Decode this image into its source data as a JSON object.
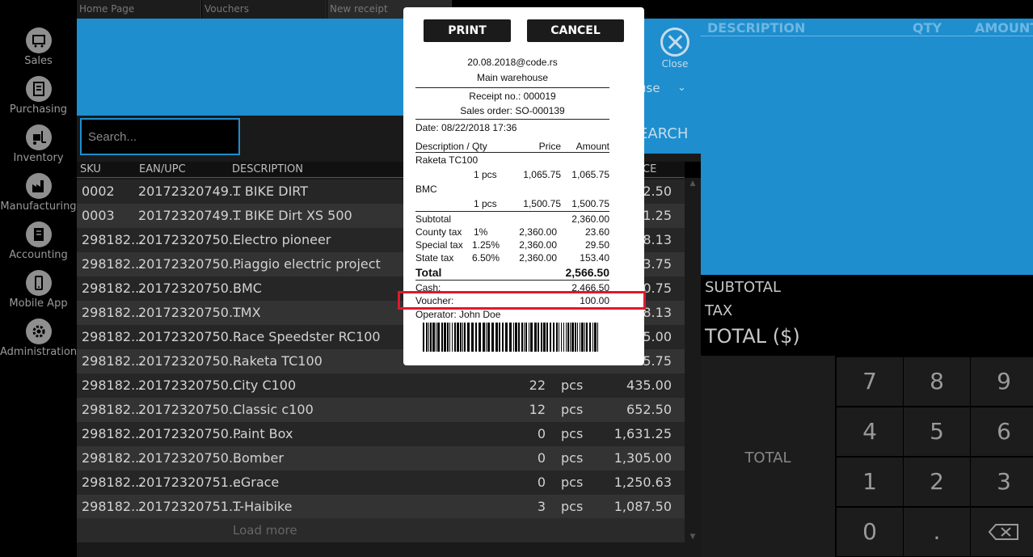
{
  "sidebar": {
    "items": [
      {
        "label": "Sales",
        "icon": "cart-icon"
      },
      {
        "label": "Purchasing",
        "icon": "receipt-icon"
      },
      {
        "label": "Inventory",
        "icon": "forklift-icon"
      },
      {
        "label": "Manufacturing",
        "icon": "factory-icon"
      },
      {
        "label": "Accounting",
        "icon": "ledger-icon"
      },
      {
        "label": "Mobile App",
        "icon": "phone-icon"
      },
      {
        "label": "Administration",
        "icon": "gear-icon"
      }
    ]
  },
  "tabs": [
    {
      "label": "Home Page"
    },
    {
      "label": "Vouchers"
    },
    {
      "label": "New receipt"
    }
  ],
  "header": {
    "close_label": "Close",
    "warehouse_partial": "use",
    "search_button": "EARCH"
  },
  "search": {
    "placeholder": "Search..."
  },
  "table": {
    "columns": {
      "sku": "SKU",
      "ean": "EAN/UPC",
      "description": "DESCRIPTION",
      "price": "CE"
    },
    "rows": [
      {
        "sku": "0002",
        "ean": "20172320749...",
        "description": "T BIKE DIRT",
        "qty": "",
        "unit": "",
        "price": "652.50"
      },
      {
        "sku": "0003",
        "ean": "20172320749...",
        "description": "T BIKE Dirt XS 500",
        "qty": "",
        "unit": "",
        "price": "51.25"
      },
      {
        "sku": "298182...",
        "ean": "20172320750...",
        "description": "Electro pioneer",
        "qty": "",
        "unit": "",
        "price": "58.13"
      },
      {
        "sku": "298182...",
        "ean": "20172320750...",
        "description": "Piaggio electric project",
        "qty": "",
        "unit": "",
        "price": "93.75"
      },
      {
        "sku": "298182...",
        "ean": "20172320750...",
        "description": "BMC",
        "qty": "",
        "unit": "",
        "price": "00.75"
      },
      {
        "sku": "298182...",
        "ean": "20172320750...",
        "description": "TMX",
        "qty": "",
        "unit": "",
        "price": "98.13"
      },
      {
        "sku": "298182...",
        "ean": "20172320750...",
        "description": "Race Speedster RC100",
        "qty": "",
        "unit": "",
        "price": "05.00"
      },
      {
        "sku": "298182...",
        "ean": "20172320750...",
        "description": "Raketa TC100",
        "qty": "",
        "unit": "",
        "price": "65.75"
      },
      {
        "sku": "298182...",
        "ean": "20172320750...",
        "description": "City C100",
        "qty": "22",
        "unit": "pcs",
        "price": "435.00"
      },
      {
        "sku": "298182...",
        "ean": "20172320750...",
        "description": "Classic c100",
        "qty": "12",
        "unit": "pcs",
        "price": "652.50"
      },
      {
        "sku": "298182...",
        "ean": "20172320750...",
        "description": "Paint Box",
        "qty": "0",
        "unit": "pcs",
        "price": "1,631.25"
      },
      {
        "sku": "298182...",
        "ean": "20172320750...",
        "description": "Bomber",
        "qty": "0",
        "unit": "pcs",
        "price": "1,305.00"
      },
      {
        "sku": "298182...",
        "ean": "20172320751...",
        "description": "eGrace",
        "qty": "0",
        "unit": "pcs",
        "price": "1,250.63"
      },
      {
        "sku": "298182...",
        "ean": "20172320751...",
        "description": "T-Haibike",
        "qty": "3",
        "unit": "pcs",
        "price": "1,087.50"
      }
    ],
    "load_more": "Load more"
  },
  "cart": {
    "col_description": "DESCRIPTION",
    "col_qty": "QTY",
    "col_amount": "AMOUNT"
  },
  "totals": {
    "subtotal": "SUBTOTAL",
    "tax": "TAX",
    "total": "TOTAL ($)"
  },
  "keypad": {
    "total_button": "TOTAL",
    "keys": [
      "7",
      "8",
      "9",
      "4",
      "5",
      "6",
      "1",
      "2",
      "3",
      "0",
      "."
    ],
    "backspace_icon": "backspace-icon"
  },
  "modal": {
    "print": "PRINT",
    "cancel": "CANCEL",
    "receipt": {
      "company": "20.08.2018@code.rs",
      "warehouse": "Main warehouse",
      "receipt_no": "Receipt no.: 000019",
      "sales_order": "Sales order: SO-000139",
      "date": "Date: 08/22/2018 17:36",
      "head_desc": "Description / Qty",
      "head_price": "Price",
      "head_amount": "Amount",
      "items": [
        {
          "name": "Raketa TC100",
          "qty": "1 pcs",
          "price": "1,065.75",
          "amount": "1,065.75"
        },
        {
          "name": "BMC",
          "qty": "1 pcs",
          "price": "1,500.75",
          "amount": "1,500.75"
        }
      ],
      "subtotal_label": "Subtotal",
      "subtotal": "2,360.00",
      "taxes": [
        {
          "name": "County tax",
          "rate": "1%",
          "base": "2,360.00",
          "amount": "23.60"
        },
        {
          "name": "Special tax",
          "rate": "1.25%",
          "base": "2,360.00",
          "amount": "29.50"
        },
        {
          "name": "State tax",
          "rate": "6.50%",
          "base": "2,360.00",
          "amount": "153.40"
        }
      ],
      "total_label": "Total",
      "total": "2,566.50",
      "cash_label": "Cash:",
      "cash": "2,466.50",
      "voucher_label": "Voucher:",
      "voucher": "100.00",
      "operator": "Operator: John Doe"
    }
  },
  "colors": {
    "accent": "#1e8ecf",
    "highlight": "#e0182b"
  }
}
